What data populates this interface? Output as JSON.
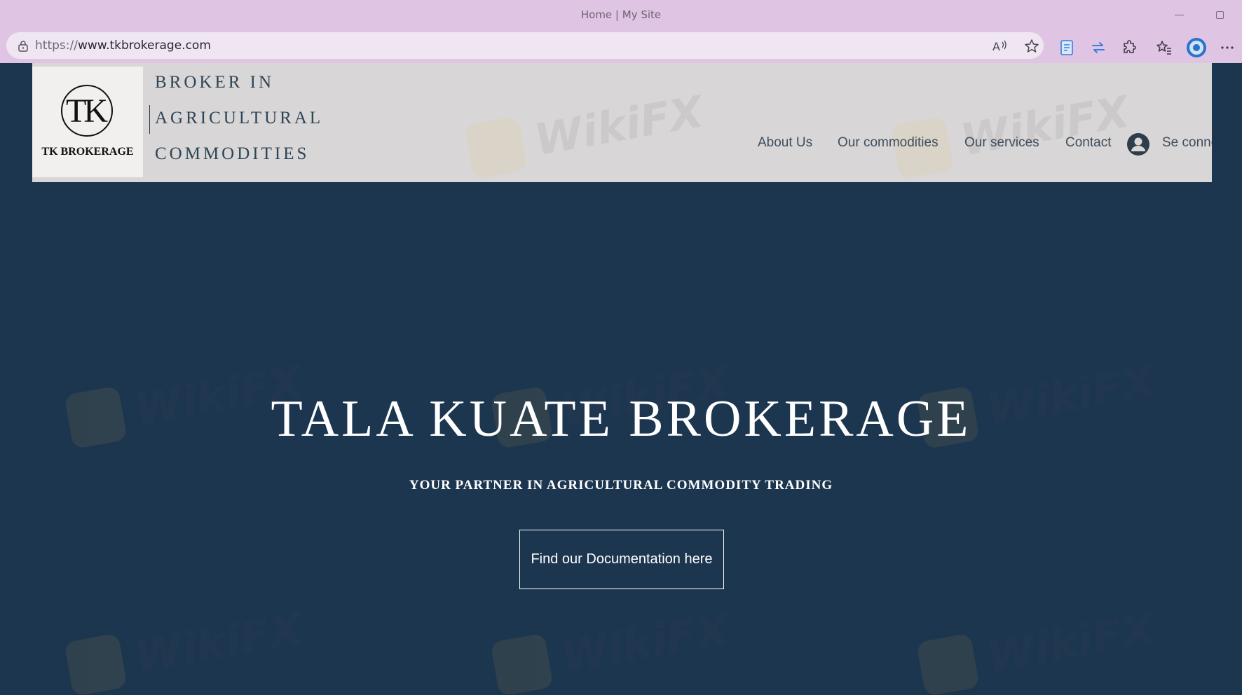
{
  "browser": {
    "window_title": "Home | My Site",
    "url_scheme": "https://",
    "url_host": "www.tkbrokerage.com",
    "icons": {
      "lock": "lock-icon",
      "read_aloud": "read-aloud-icon",
      "favorite": "star-icon",
      "document": "document-icon",
      "sync": "sync-icon",
      "extensions": "puzzle-icon",
      "favorites_list": "favorites-icon",
      "profile": "profile-icon",
      "more": "more-icon"
    }
  },
  "header": {
    "logo_monogram": "TK",
    "logo_name": "TK BROKERAGE",
    "tagline_lines": [
      "BROKER IN",
      "AGRICULTURAL",
      "COMMODITIES"
    ],
    "nav": [
      {
        "label": "About Us"
      },
      {
        "label": "Our commodities"
      },
      {
        "label": "Our services"
      },
      {
        "label": "Contact"
      }
    ],
    "login_label": "Se connecter"
  },
  "hero": {
    "title": "TALA KUATE BROKERAGE",
    "subtitle": "YOUR PARTNER IN AGRICULTURAL COMMODITY TRADING",
    "button_label": "Find our Documentation here"
  },
  "watermark_text": "WikiFX",
  "colors": {
    "chrome": "#dfc4e4",
    "address_bar": "#efe6f1",
    "header_bg": "#d8d6d7",
    "hero_bg": "#1d3650",
    "accent_text": "#2e4556"
  }
}
